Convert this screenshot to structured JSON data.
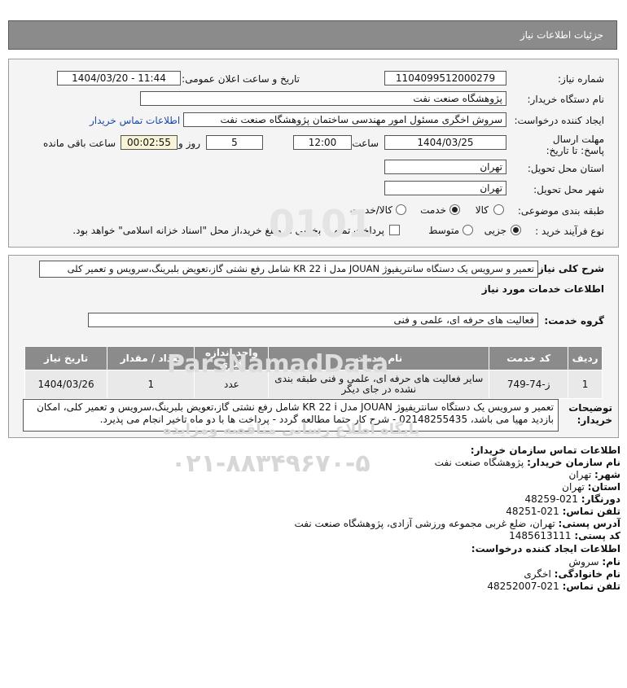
{
  "header": {
    "title": "جزئیات اطلاعات نیاز"
  },
  "details": {
    "need_number_label": "شماره نیاز:",
    "need_number": "1104099512000279",
    "announce_label": "تاریخ و ساعت اعلان عمومی:",
    "announce_value": "1404/03/20 - 11:44",
    "buyer_label": "نام دستگاه خریدار:",
    "buyer_value": "پژوهشگاه صنعت نفت",
    "creator_label": "ایجاد کننده درخواست:",
    "creator_value": "سروش اخگری مسئول امور مهندسی ساختمان پژوهشگاه صنعت نفت",
    "contact_link": "اطلاعات تماس خریدار",
    "deadline_label": "مهلت ارسال پاسخ: تا تاریخ:",
    "deadline_date": "1404/03/25",
    "time_label": "ساعت",
    "deadline_time": "12:00",
    "days_value": "5",
    "days_label": "روز و",
    "timer_value": "00:02:55",
    "remaining_label": "ساعت باقی مانده",
    "province_label": "استان محل تحویل:",
    "province_value": "تهران",
    "city_label": "شهر محل تحویل:",
    "city_value": "تهران",
    "category_label": "طبقه بندی موضوعی:",
    "category_options": [
      "کالا",
      "خدمت",
      "کالا/خدمت"
    ],
    "process_label": "نوع فرآیند خرید :",
    "process_options": [
      "جزیی",
      "متوسط"
    ],
    "payment_text": "پرداخت تمام یا بخشی از مبلغ خرید،از محل \"اسناد خزانه اسلامی\" خواهد بود."
  },
  "summary": {
    "label": "شرح کلی نیاز:",
    "value": "تعمیر و سرویس یک دستگاه سانتریفیوژ JOUAN مدل KR 22 i شامل رفع نشتی گاز،تعویض بلبرینگ،سرویس و تعمیر کلی"
  },
  "services_title": "اطلاعات خدمات مورد نیاز",
  "service_group_label": "گروه خدمت:",
  "service_group_value": "فعالیت های حرفه ای، علمی و فنی",
  "table": {
    "headers": [
      "ردیف",
      "کد خدمت",
      "نام خدمت",
      "واحد اندازه گیری",
      "تعداد / مقدار",
      "تاریخ نیاز"
    ],
    "rows": [
      [
        "1",
        "ز-74-749",
        "سایر فعالیت های حرفه ای، علمی و فنی طبقه بندی نشده در جای دیگر",
        "عدد",
        "1",
        "1404/03/26"
      ]
    ]
  },
  "buyer_notes": {
    "label": "توضیحات خریدار:",
    "value": "تعمیر و سرویس یک دستگاه سانتریفیوژ JOUAN مدل KR 22 i شامل رفع نشتی گاز،تعویض بلبرینگ،سرویس و تعمیر کلی، امکان بازدید مهیا می باشد، 02148255435 - شرح کار حتما مطالعه گردد - پرداخت ها با دو ماه تاخیر انجام می پذیرد."
  },
  "contact": {
    "title": "اطلاعات تماس سازمان خریدار:",
    "org_label": "نام سازمان خریدار:",
    "org_value": "پژوهشگاه صنعت نفت",
    "city_label": "شهر:",
    "city_value": "تهران",
    "province_label": "استان:",
    "province_value": "تهران",
    "fax_label": "دورنگار:",
    "fax_value": "021-48259",
    "phone_label": "تلفن تماس:",
    "phone_value": "021-48251",
    "address_label": "آدرس پستی:",
    "address_value": "تهران، ضلع غربی مجموعه ورزشی آزادی، پژوهشگاه صنعت نفت",
    "postal_label": "کد پستی:",
    "postal_value": "1485613111",
    "creator_title": "اطلاعات ایجاد کننده درخواست:",
    "name_label": "نام:",
    "name_value": "سروش",
    "family_label": "نام خانوادگی:",
    "family_value": "اخگری",
    "cphone_label": "تلفن تماس:",
    "cphone_value": "021-48252007"
  },
  "watermark": {
    "phone": "۰۲۱-۸۸۳۴۹۶۷۰-۵",
    "line1": "پایگاه اطلاع رسانی مناقصه ومزایده",
    "brand": "ParsNamadData"
  }
}
